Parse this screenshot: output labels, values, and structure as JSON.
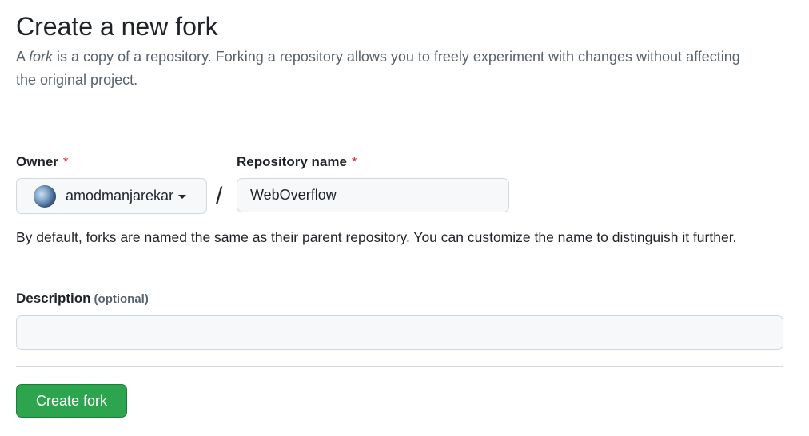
{
  "header": {
    "title": "Create a new fork",
    "subtitle_prefix": "A ",
    "subtitle_em": "fork",
    "subtitle_rest": " is a copy of a repository. Forking a repository allows you to freely experiment with changes without affecting the original project."
  },
  "form": {
    "owner": {
      "label": "Owner",
      "required_mark": "*",
      "value": "amodmanjarekar",
      "icon": "chevron-down-icon"
    },
    "separator": "/",
    "repository": {
      "label": "Repository name",
      "required_mark": "*",
      "value": "WebOverflow"
    },
    "hint": "By default, forks are named the same as their parent repository. You can customize the name to distinguish it further.",
    "description": {
      "label": "Description",
      "optional_text": "(optional)",
      "value": ""
    },
    "submit_label": "Create fork"
  },
  "colors": {
    "primary_button": "#2da44e",
    "required": "#d1242f",
    "muted_text": "#59636e",
    "border": "#d1d9e0"
  }
}
